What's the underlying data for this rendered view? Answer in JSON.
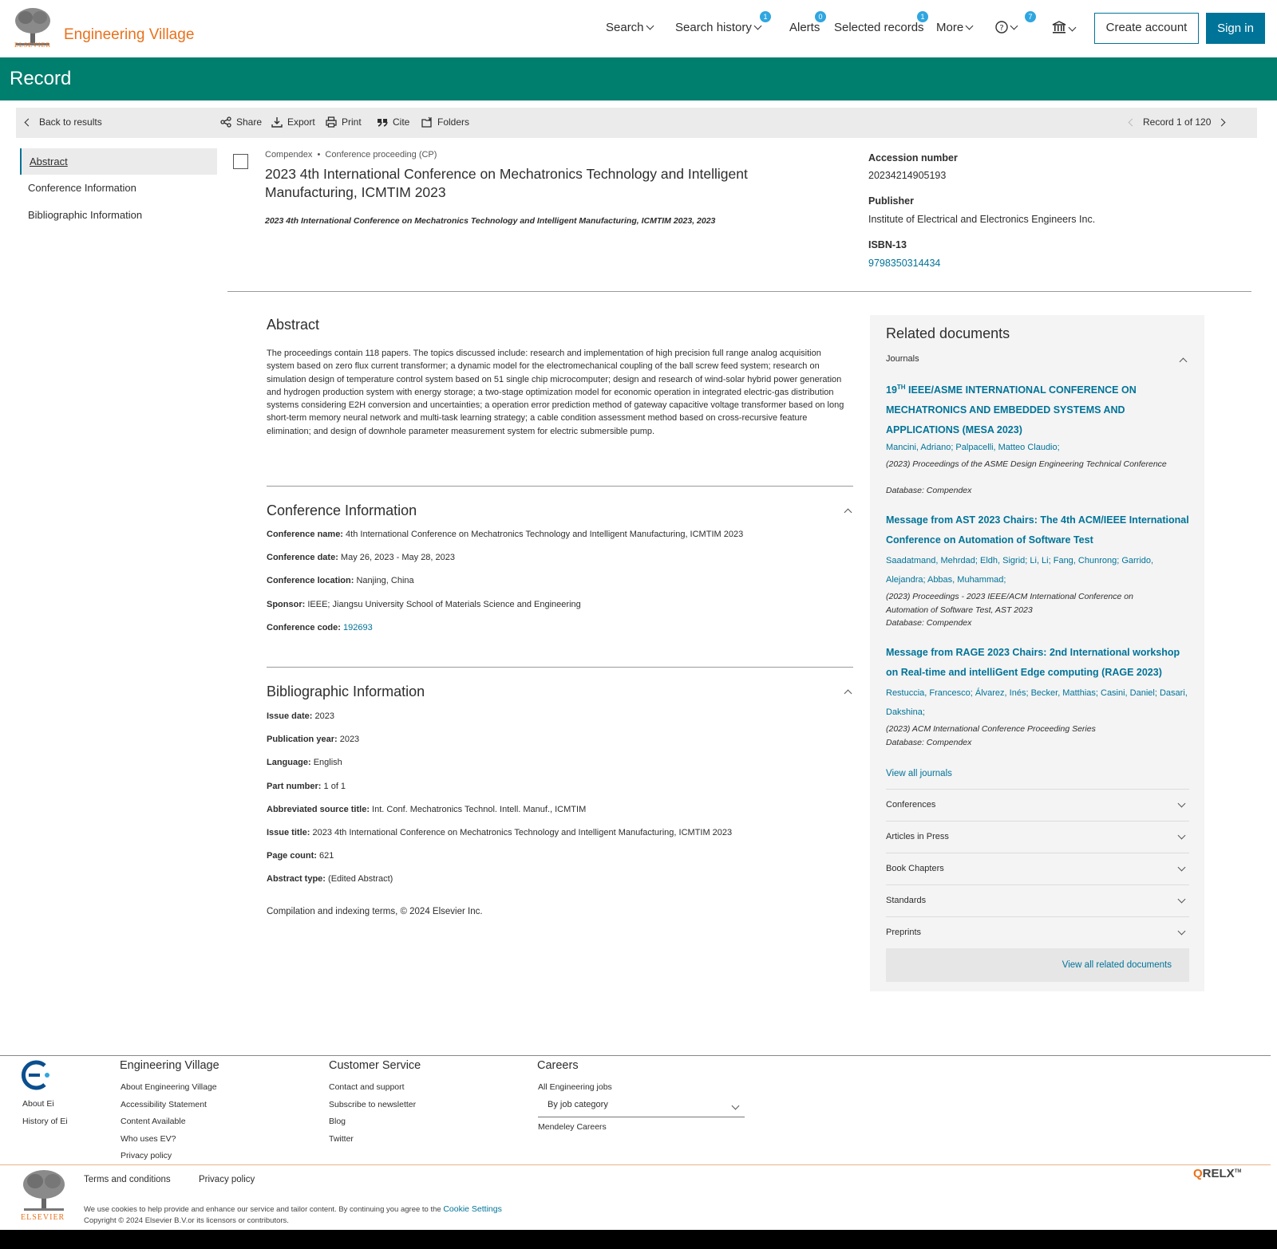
{
  "header": {
    "logo_text": "ELSEVIER",
    "brand": "Engineering Village",
    "nav": {
      "search": "Search",
      "search_history": "Search history",
      "search_history_badge": "1",
      "alerts": "Alerts",
      "alerts_badge": "0",
      "selected_records": "Selected records",
      "selected_records_badge": "1",
      "more": "More",
      "help_badge": "7"
    },
    "create_account": "Create account",
    "sign_in": "Sign in"
  },
  "page_title": "Record",
  "toolbar": {
    "back": "Back to results",
    "share": "Share",
    "export": "Export",
    "print": "Print",
    "cite": "Cite",
    "folders": "Folders",
    "record_counter": "Record 1 of 120"
  },
  "left_nav": [
    "Abstract",
    "Conference Information",
    "Bibliographic Information"
  ],
  "record": {
    "database": "Compendex",
    "doc_type": "Conference proceeding (CP)",
    "title": "2023 4th International Conference on Mechatronics Technology and Intelligent Manufacturing, ICMTIM 2023",
    "source": "2023 4th International Conference on Mechatronics Technology and Intelligent Manufacturing, ICMTIM 2023, 2023",
    "accession_label": "Accession number",
    "accession_value": "20234214905193",
    "publisher_label": "Publisher",
    "publisher_value": "Institute of Electrical and Electronics Engineers Inc.",
    "isbn_label": "ISBN-13",
    "isbn_value": "9798350314434"
  },
  "abstract": {
    "heading": "Abstract",
    "text": "The proceedings contain 118 papers. The topics discussed include: research and implementation of high precision full range analog acquisition system based on zero flux current transformer; a dynamic model for the electromechanical coupling of the ball screw feed system; research on simulation design of temperature control system based on 51 single chip microcomputer; design and research of wind-solar hybrid power generation and hydrogen production system with energy storage; a two-stage optimization model for economic operation in integrated electric-gas distribution systems considering E2H conversion and uncertainties; a operation error prediction method of gateway capacitive voltage transformer based on long short-term memory neural network and multi-task learning strategy; a cable condition assessment method based on cross-recursive feature elimination; and design of downhole parameter measurement system for electric submersible pump."
  },
  "conference": {
    "heading": "Conference Information",
    "fields": [
      {
        "label": "Conference name:",
        "value": "4th International Conference on Mechatronics Technology and Intelligent Manufacturing, ICMTIM 2023"
      },
      {
        "label": "Conference date:",
        "value": "May 26, 2023 - May 28, 2023"
      },
      {
        "label": "Conference location:",
        "value": "Nanjing, China"
      },
      {
        "label": "Sponsor:",
        "value": "IEEE; Jiangsu University School of Materials Science and Engineering"
      },
      {
        "label": "Conference code:",
        "value": "192693"
      }
    ]
  },
  "bibliographic": {
    "heading": "Bibliographic Information",
    "fields": [
      {
        "label": "Issue date:",
        "value": "2023"
      },
      {
        "label": "Publication year:",
        "value": "2023"
      },
      {
        "label": "Language:",
        "value": "English"
      },
      {
        "label": "Part number:",
        "value": "1 of 1"
      },
      {
        "label": "Abbreviated source title:",
        "value": "Int. Conf. Mechatronics Technol. Intell. Manuf., ICMTIM"
      },
      {
        "label": "Issue title:",
        "value": "2023 4th International Conference on Mechatronics Technology and Intelligent Manufacturing, ICMTIM 2023"
      },
      {
        "label": "Page count:",
        "value": "621"
      },
      {
        "label": "Abstract type:",
        "value": "(Edited Abstract)"
      }
    ],
    "compilation": "Compilation and indexing terms, © 2024 Elsevier Inc."
  },
  "related": {
    "heading": "Related documents",
    "journals_label": "Journals",
    "docs": [
      {
        "title_pre": "19",
        "title_sup": "TH",
        "title": " IEEE/ASME INTERNATIONAL CONFERENCE ON MECHATRONICS AND EMBEDDED SYSTEMS AND APPLICATIONS (MESA 2023)",
        "authors": "Mancini, Adriano; Palpacelli, Matteo Claudio;",
        "source": "(2023) Proceedings of the ASME Design Engineering Technical Conference",
        "database": "Database: Compendex"
      },
      {
        "title": "Message from AST 2023 Chairs: The 4th ACM/IEEE International Conference on Automation of Software Test",
        "authors": "Saadatmand, Mehrdad; Eldh, Sigrid;  Li, Li;  Fang, Chunrong; Garrido, Alejandra; Abbas, Muhammad;",
        "source": "(2023) Proceedings - 2023 IEEE/ACM International Conference on Automation of Software Test, AST 2023",
        "database": "Database: Compendex"
      },
      {
        "title": "Message from RAGE 2023 Chairs: 2nd International workshop on Real-time and intelliGent Edge computing (RAGE 2023)",
        "authors": "Restuccia, Francesco; Álvarez, Inés; Becker, Matthias; Casini, Daniel; Dasari, Dakshina;",
        "source": "(2023) ACM International Conference Proceeding Series",
        "database": "Database: Compendex"
      }
    ],
    "view_all_journals": "View all journals",
    "categories": [
      "Conferences",
      "Articles in Press",
      "Book Chapters",
      "Standards",
      "Preprints"
    ],
    "view_all": "View all related documents"
  },
  "footer": {
    "about_ei": "About Ei",
    "history_ei": "History of Ei",
    "col1": {
      "heading": "Engineering Village",
      "links": [
        "About Engineering Village",
        "Accessibility Statement",
        "Content Available",
        "Who uses EV?",
        "Privacy policy"
      ]
    },
    "col2": {
      "heading": "Customer Service",
      "links": [
        "Contact and support",
        "Subscribe to newsletter",
        "Blog",
        "Twitter"
      ]
    },
    "col3": {
      "heading": "Careers",
      "links": [
        "All Engineering jobs",
        "Mendeley Careers"
      ],
      "select": "By job category"
    },
    "terms": "Terms and conditions",
    "privacy": "Privacy policy",
    "cookie_text": "We use cookies to help provide and enhance our service and tailor content. By continuing you agree to the ",
    "cookie_link": "Cookie Settings",
    "copyright": "Copyright © 2024 Elsevier B.V.or its licensors or contributors.",
    "relx": "RELX",
    "relx_tm": "TM",
    "elsevier": "ELSEVIER"
  }
}
